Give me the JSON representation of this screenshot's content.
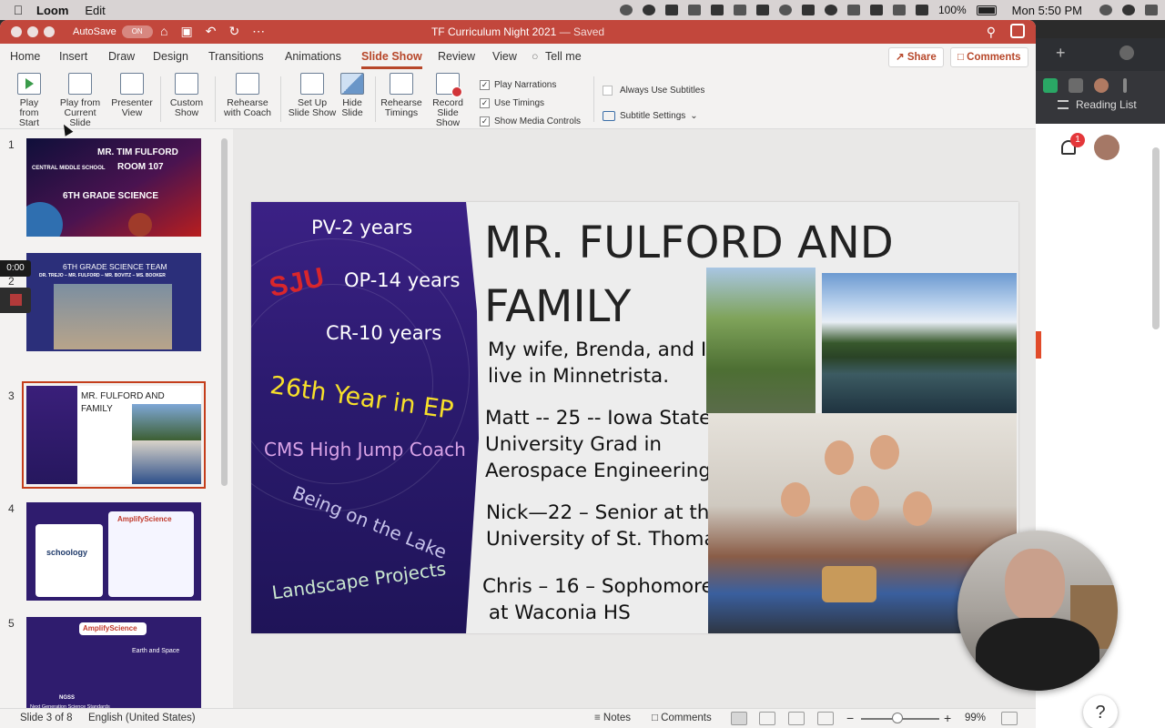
{
  "menubar": {
    "apple": "",
    "app_name": "Loom",
    "items": [
      "Edit"
    ],
    "battery": "100%",
    "clock": "Mon 5:50 PM"
  },
  "window": {
    "autosave_label": "AutoSave",
    "autosave_state": "ON",
    "title": "TF Curriculum Night 2021",
    "title_status": "— Saved"
  },
  "ribbon_tabs": [
    "Home",
    "Insert",
    "Draw",
    "Design",
    "Transitions",
    "Animations",
    "Slide Show",
    "Review",
    "View",
    "Tell me"
  ],
  "active_tab": "Slide Show",
  "share_label": "Share",
  "comments_label": "Comments",
  "ribbon": {
    "play_from_start": [
      "Play from",
      "Start"
    ],
    "play_from_current": [
      "Play from",
      "Current Slide"
    ],
    "presenter_view": [
      "Presenter",
      "View"
    ],
    "custom_show": [
      "Custom",
      "Show"
    ],
    "rehearse_coach": [
      "Rehearse",
      "with Coach"
    ],
    "setup_show": [
      "Set Up",
      "Slide Show"
    ],
    "hide_slide": [
      "Hide",
      "Slide"
    ],
    "rehearse_timings": [
      "Rehearse",
      "Timings"
    ],
    "record_show": [
      "Record",
      "Slide Show"
    ],
    "play_narrations": "Play Narrations",
    "use_timings": "Use Timings",
    "show_media_controls": "Show Media Controls",
    "always_use_subtitles": "Always Use Subtitles",
    "subtitle_settings": "Subtitle Settings"
  },
  "thumbnails": {
    "numbers": [
      "1",
      "2",
      "3",
      "4",
      "5"
    ],
    "t1": {
      "lines": [
        "MR. TIM FULFORD",
        "ROOM 107",
        "CENTRAL MIDDLE SCHOOL",
        "6TH GRADE SCIENCE"
      ]
    },
    "t2": {
      "lines": [
        "6TH GRADE SCIENCE TEAM",
        "DR. TREJO – MR. FULFORD – MR. BOVITZ – MS. BOOKER"
      ]
    },
    "t3": {
      "lines": [
        "MR. FULFORD AND",
        "FAMILY"
      ]
    },
    "t4": {
      "lines": [
        "schoology",
        "AmplifyScience"
      ]
    },
    "t5": {
      "lines": [
        "AmplifyScience",
        "Earth and Space",
        "NGSS",
        "Next Generation Science Standards"
      ]
    }
  },
  "recording": {
    "time": "0:00"
  },
  "slide": {
    "title_line1": "MR. FULFORD AND",
    "title_line2": "FAMILY",
    "left": {
      "pv": "PV-2 years",
      "sju": "SJU",
      "op": "OP-14 years",
      "cr": "CR-10 years",
      "year_in_ep": "26th Year in EP",
      "coach": "CMS High Jump Coach",
      "lake": "Being on the Lake",
      "landscape": "Landscape Projects"
    },
    "body": {
      "p1a": "My wife, Brenda, and I",
      "p1b": "live in Minnetrista.",
      "p2a": "Matt -- 25 -- Iowa State",
      "p2b": "University Grad in",
      "p2c": "Aerospace Engineering",
      "p3a": "Nick—22 – Senior at the",
      "p3b": "University of St. Thomas",
      "p4a": "Chris – 16 – Sophomore",
      "p4b": " at Waconia HS"
    }
  },
  "browser": {
    "reading_list": "Reading List",
    "notification_count": "1",
    "help": "?"
  },
  "status": {
    "slide_of": "Slide 3 of 8",
    "language": "English (United States)",
    "notes": "Notes",
    "comments": "Comments",
    "zoom": "99%"
  }
}
